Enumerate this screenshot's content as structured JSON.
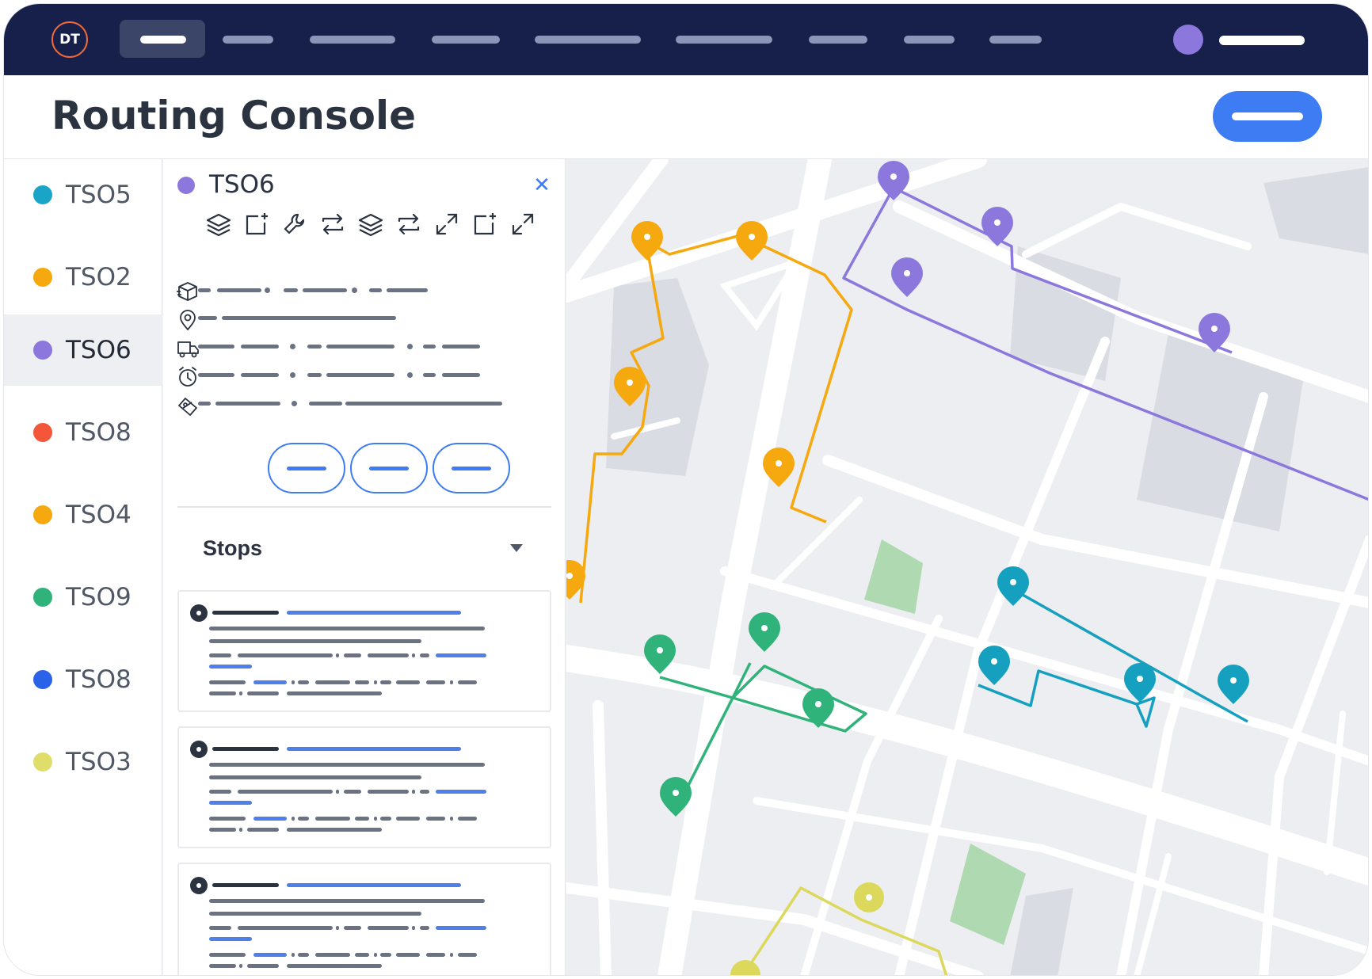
{
  "app": {
    "logo_text": "DT"
  },
  "nav": {
    "items": [
      "",
      "",
      "",
      "",
      "",
      "",
      "",
      "",
      ""
    ],
    "active_index": 0
  },
  "header": {
    "title": "Routing Console"
  },
  "routes": [
    {
      "label": "TSO5",
      "color": "#1aa5c8"
    },
    {
      "label": "TSO2",
      "color": "#f6a80f"
    },
    {
      "label": "TSO6",
      "color": "#8c78dc",
      "selected": true
    },
    {
      "label": "TSO8",
      "color": "#f4563a"
    },
    {
      "label": "TSO4",
      "color": "#f6a80f"
    },
    {
      "label": "TSO9",
      "color": "#2fb37a"
    },
    {
      "label": "TSO8",
      "color": "#2a62e8"
    },
    {
      "label": "TSO3",
      "color": "#e0de6a"
    }
  ],
  "detail": {
    "title": "TSO6",
    "color": "#8c78dc",
    "close_glyph": "✕",
    "toolbar_icons": [
      "layers-icon",
      "add-frame-icon",
      "wrench-icon",
      "swap-icon",
      "layers-icon",
      "swap-icon",
      "expand-icon",
      "add-frame-icon",
      "expand-icon"
    ],
    "info_icons": [
      "package-icon",
      "location-pin-icon",
      "truck-icon",
      "clock-icon",
      "route-icon"
    ],
    "stops_label": "Stops"
  },
  "colors": {
    "accent": "#3d7cf2",
    "navy": "#17204a",
    "orange_route": "#f6a80f",
    "purple_route": "#8c78dc",
    "teal_route": "#14a0be",
    "green_route": "#2fb37a",
    "yellow_route": "#dcd85c"
  }
}
